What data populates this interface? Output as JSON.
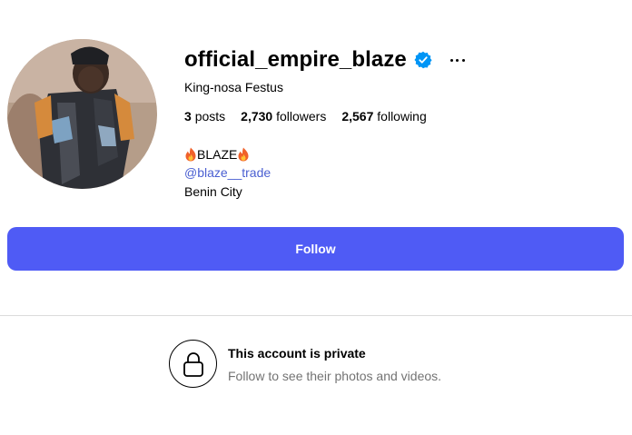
{
  "profile": {
    "username": "official_empire_blaze",
    "full_name": "King-nosa Festus",
    "verified": true,
    "stats": {
      "posts_count": "3",
      "posts_label": "posts",
      "followers_count": "2,730",
      "followers_label": "followers",
      "following_count": "2,567",
      "following_label": "following"
    },
    "bio": {
      "title": "BLAZE",
      "link": "@blaze__trade",
      "location": "Benin City"
    }
  },
  "actions": {
    "follow_label": "Follow"
  },
  "private_notice": {
    "title": "This account is private",
    "subtitle": "Follow to see their photos and videos."
  },
  "icons": {
    "verified": "verified-badge-icon",
    "more": "more-options-icon",
    "flame": "fire-emoji-icon",
    "lock": "lock-icon"
  },
  "colors": {
    "accent_button": "#4f5bf5",
    "link": "#4a5fd1",
    "verified_badge": "#0095f6",
    "muted_text": "#737373",
    "divider": "#dbdbdb"
  }
}
